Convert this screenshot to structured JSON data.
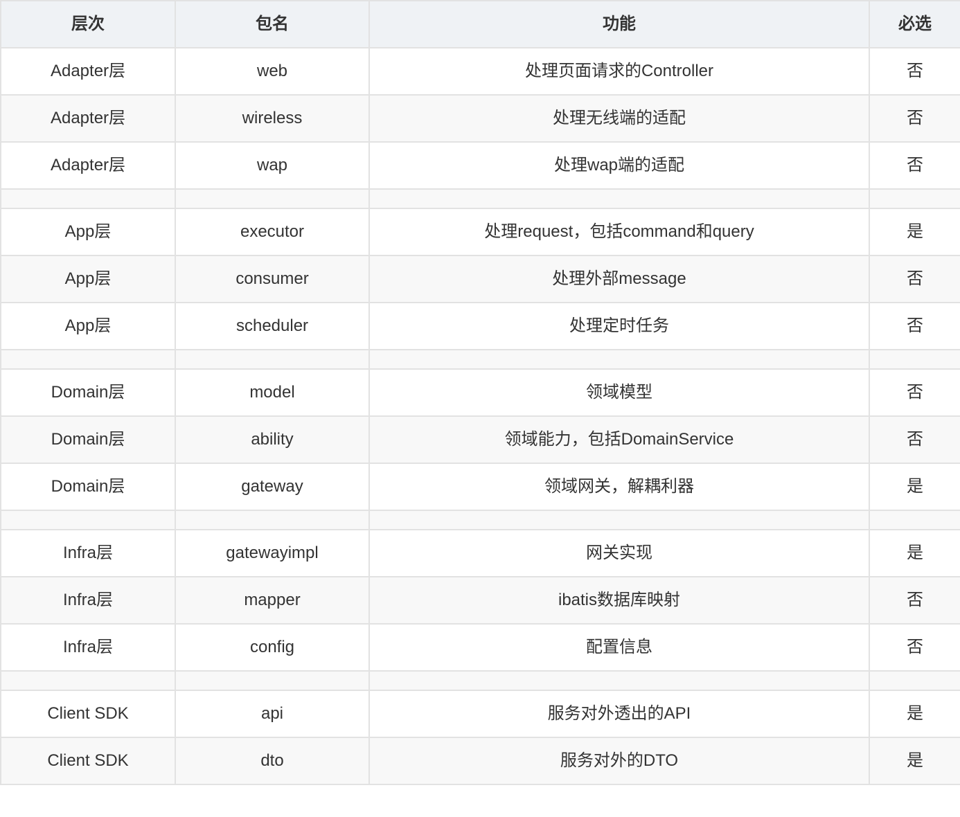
{
  "headers": [
    "层次",
    "包名",
    "功能",
    "必选"
  ],
  "rows": [
    {
      "layer": "Adapter层",
      "package": "web",
      "function": "处理页面请求的Controller",
      "required": "否"
    },
    {
      "layer": "Adapter层",
      "package": "wireless",
      "function": "处理无线端的适配",
      "required": "否"
    },
    {
      "layer": "Adapter层",
      "package": "wap",
      "function": "处理wap端的适配",
      "required": "否"
    },
    {
      "spacer": true
    },
    {
      "layer": "App层",
      "package": "executor",
      "function": "处理request，包括command和query",
      "required": "是"
    },
    {
      "layer": "App层",
      "package": "consumer",
      "function": "处理外部message",
      "required": "否"
    },
    {
      "layer": "App层",
      "package": "scheduler",
      "function": "处理定时任务",
      "required": "否"
    },
    {
      "spacer": true
    },
    {
      "layer": "Domain层",
      "package": "model",
      "function": "领域模型",
      "required": "否"
    },
    {
      "layer": "Domain层",
      "package": "ability",
      "function": "领域能力，包括DomainService",
      "required": "否"
    },
    {
      "layer": "Domain层",
      "package": "gateway",
      "function": "领域网关，解耦利器",
      "required": "是"
    },
    {
      "spacer": true
    },
    {
      "layer": "Infra层",
      "package": "gatewayimpl",
      "function": "网关实现",
      "required": "是"
    },
    {
      "layer": "Infra层",
      "package": "mapper",
      "function": "ibatis数据库映射",
      "required": "否"
    },
    {
      "layer": "Infra层",
      "package": "config",
      "function": "配置信息",
      "required": "否"
    },
    {
      "spacer": true
    },
    {
      "layer": "Client SDK",
      "package": "api",
      "function": "服务对外透出的API",
      "required": "是"
    },
    {
      "layer": "Client SDK",
      "package": "dto",
      "function": "服务对外的DTO",
      "required": "是"
    }
  ]
}
